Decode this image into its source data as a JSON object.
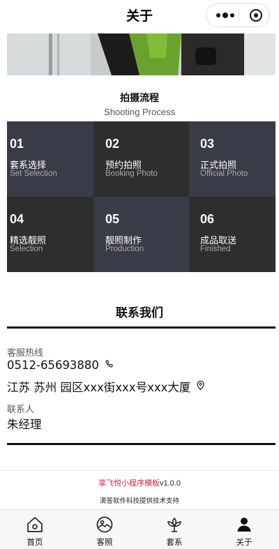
{
  "nav": {
    "title": "关于"
  },
  "process": {
    "title": "拍摄流程",
    "subtitle": "Shooting Process",
    "steps": [
      {
        "num": "01",
        "zh": "套系选择",
        "en": "Set Selection",
        "bg": "#393c46"
      },
      {
        "num": "02",
        "zh": "预约拍照",
        "en": "Booking Photo",
        "bg": "#2e2e2e"
      },
      {
        "num": "03",
        "zh": "正式拍照",
        "en": "Official Photo",
        "bg": "#393c46"
      },
      {
        "num": "04",
        "zh": "精选靓照",
        "en": "Selection",
        "bg": "#2e2e2e"
      },
      {
        "num": "05",
        "zh": "靓照制作",
        "en": "Production",
        "bg": "#393c46"
      },
      {
        "num": "06",
        "zh": "成品取送",
        "en": "Finished",
        "bg": "#2e2e2e"
      }
    ]
  },
  "contact": {
    "title": "联系我们",
    "hotline_label": "客服热线",
    "hotline": "0512-65693880",
    "address": "江苏 苏州 园区xxx街xxx号xxx大厦",
    "person_label": "联系人",
    "person": "朱经理"
  },
  "footer": {
    "brand": "享飞悦小程序模板",
    "version": "v1.0.0",
    "support": "滴答软件科技提供技术支持"
  },
  "tabbar": [
    {
      "label": "首页",
      "icon": "home-icon"
    },
    {
      "label": "客照",
      "icon": "photo-icon"
    },
    {
      "label": "套系",
      "icon": "flower-icon"
    },
    {
      "label": "关于",
      "icon": "user-icon"
    }
  ],
  "colors": {
    "accent": "#e0203c",
    "dark_cell": "#2e2e2e",
    "slate_cell": "#393c46"
  }
}
